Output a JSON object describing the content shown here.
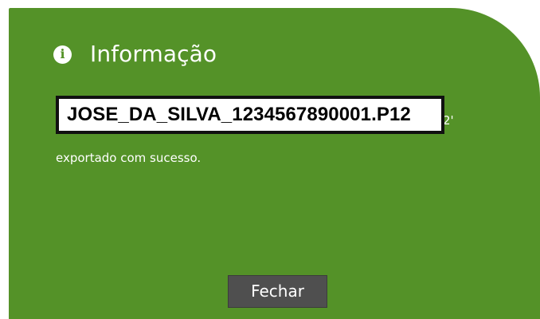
{
  "dialog": {
    "title": "Informação",
    "icon": "info-icon",
    "accent_color": "#549228",
    "file_name": "JOSE_DA_SILVA_1234567890001.P12",
    "partial_suffix": "2'",
    "message": "exportado com sucesso.",
    "close_label": "Fechar"
  }
}
